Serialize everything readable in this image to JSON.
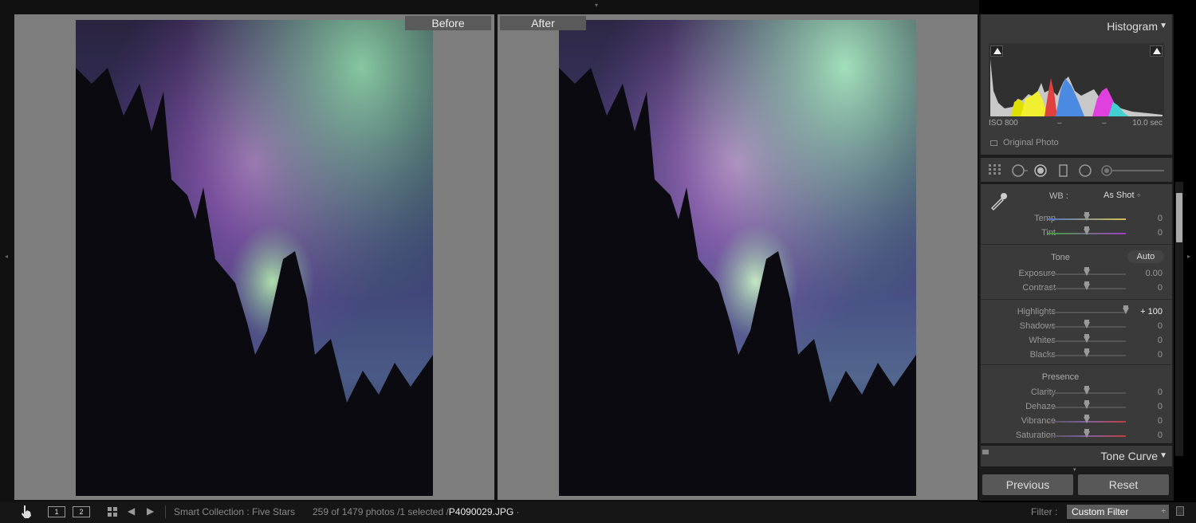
{
  "compare": {
    "before_label": "Before",
    "after_label": "After"
  },
  "histogram": {
    "title": "Histogram",
    "iso": "ISO 800",
    "dash1": "–",
    "dash2": "–",
    "shutter": "10.0 sec",
    "original_photo_label": "Original Photo"
  },
  "basic": {
    "wb_label": "WB :",
    "wb_value": "As Shot",
    "wb_arrow": "÷",
    "temp": {
      "label": "Temp",
      "value": "0",
      "level": 0.5
    },
    "tint": {
      "label": "Tint",
      "value": "0",
      "level": 0.5
    },
    "tone_label": "Tone",
    "auto_label": "Auto",
    "exposure": {
      "label": "Exposure",
      "value": "0.00",
      "level": 0.5
    },
    "contrast": {
      "label": "Contrast",
      "value": "0",
      "level": 0.5
    },
    "highlights": {
      "label": "Highlights",
      "value": "+ 100",
      "level": 1.0
    },
    "shadows": {
      "label": "Shadows",
      "value": "0",
      "level": 0.5
    },
    "whites": {
      "label": "Whites",
      "value": "0",
      "level": 0.5
    },
    "blacks": {
      "label": "Blacks",
      "value": "0",
      "level": 0.5
    },
    "presence_label": "Presence",
    "clarity": {
      "label": "Clarity",
      "value": "0",
      "level": 0.5
    },
    "dehaze": {
      "label": "Dehaze",
      "value": "0",
      "level": 0.5
    },
    "vibrance": {
      "label": "Vibrance",
      "value": "0",
      "level": 0.5
    },
    "saturation": {
      "label": "Saturation",
      "value": "0",
      "level": 0.5
    }
  },
  "tone_curve": {
    "title": "Tone Curve"
  },
  "buttons": {
    "previous": "Previous",
    "reset": "Reset"
  },
  "bottom": {
    "page1": "1",
    "page2": "2",
    "collection": "Smart Collection : Five Stars",
    "count": "259 of 1479 photos /1 selected /",
    "filename": "P4090029.JPG",
    "filename_suffix": "·",
    "filter_label": "Filter :",
    "filter_value": "Custom Filter",
    "filter_arrow": "÷"
  },
  "colors": {
    "panel_bg": "#3a3a3a",
    "compare_bg": "#7d7d7d",
    "button_bg": "#585858"
  },
  "icons": [
    "arrow-up-icon",
    "arrow-left-icon",
    "arrow-right-icon",
    "triangle-down-icon",
    "eyedropper-icon",
    "grid-overlay-icon",
    "crop-icon",
    "spot-removal-icon",
    "red-eye-icon",
    "graduated-filter-icon",
    "radial-filter-icon",
    "brush-icon",
    "hand-cursor-icon",
    "grid-view-icon",
    "nav-back-icon",
    "nav-forward-icon"
  ]
}
